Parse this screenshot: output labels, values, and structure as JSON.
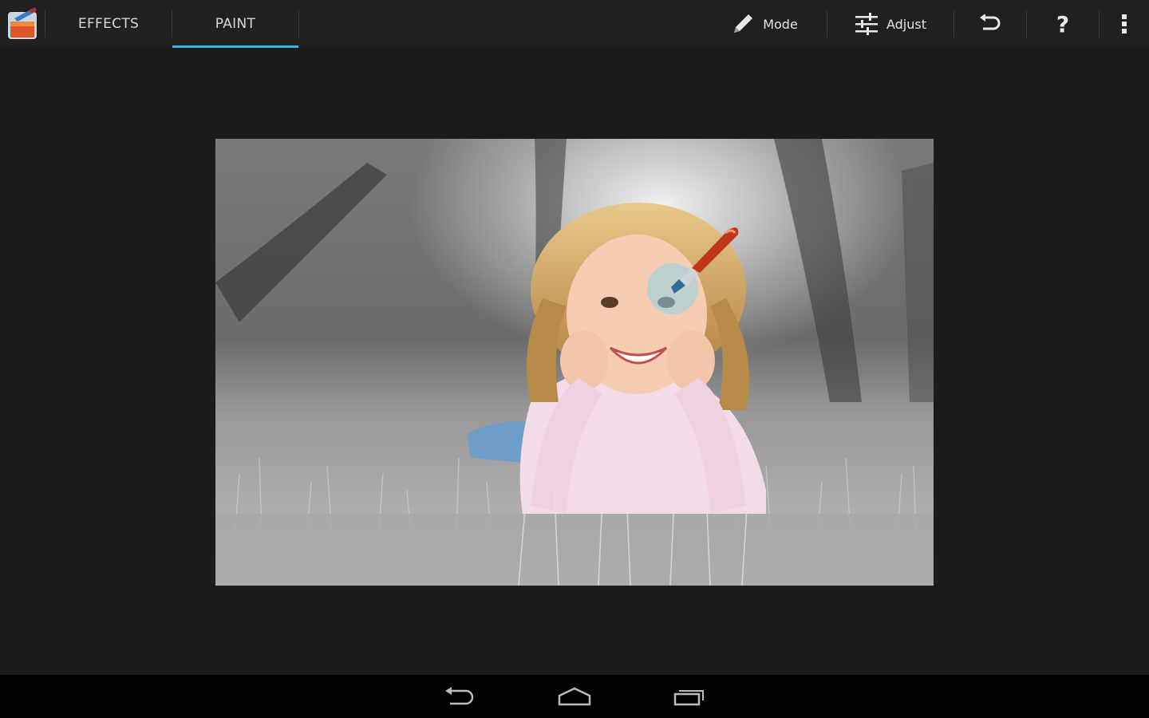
{
  "app": {
    "icon": "paint-bucket-icon"
  },
  "tabs": [
    {
      "label": "EFFECTS",
      "selected": false
    },
    {
      "label": "PAINT",
      "selected": true
    }
  ],
  "actions": {
    "mode": {
      "label": "Mode",
      "icon": "pencil-icon"
    },
    "adjust": {
      "label": "Adjust",
      "icon": "sliders-icon"
    },
    "undo": {
      "icon": "undo-icon"
    },
    "help": {
      "label": "?",
      "icon": "help-icon"
    },
    "overflow": {
      "icon": "overflow-menu-icon"
    }
  },
  "canvas": {
    "photo": "selective-color-photo-girl-on-grass",
    "brush": "paint-brush-cursor-icon"
  },
  "nav": {
    "back": "back-icon",
    "home": "home-icon",
    "recents": "recent-apps-icon"
  },
  "colors": {
    "accent": "#33b5e5",
    "actionbar": "#202020",
    "background": "#1b1b1b",
    "navbar": "#000000"
  }
}
